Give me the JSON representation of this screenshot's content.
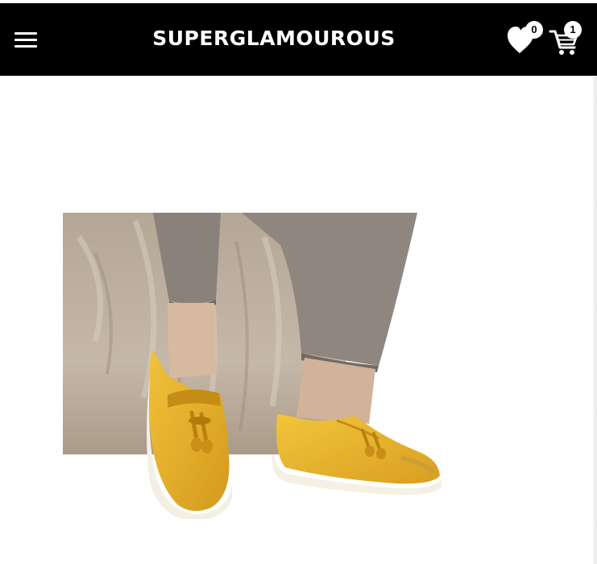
{
  "header": {
    "logo_text": "SUPERGLAMOUROUS",
    "menu_icon": "hamburger-menu-icon",
    "wishlist": {
      "icon": "heart-icon",
      "count": "0"
    },
    "cart": {
      "icon": "cart-icon",
      "count": "1"
    }
  },
  "colors": {
    "header_background": "#000000",
    "header_foreground": "#ffffff",
    "page_background": "#ffffff",
    "shoe_yellow": "#e9b62a",
    "trouser_grey": "#8a817b"
  },
  "product": {
    "image_icon": "product-photo"
  }
}
